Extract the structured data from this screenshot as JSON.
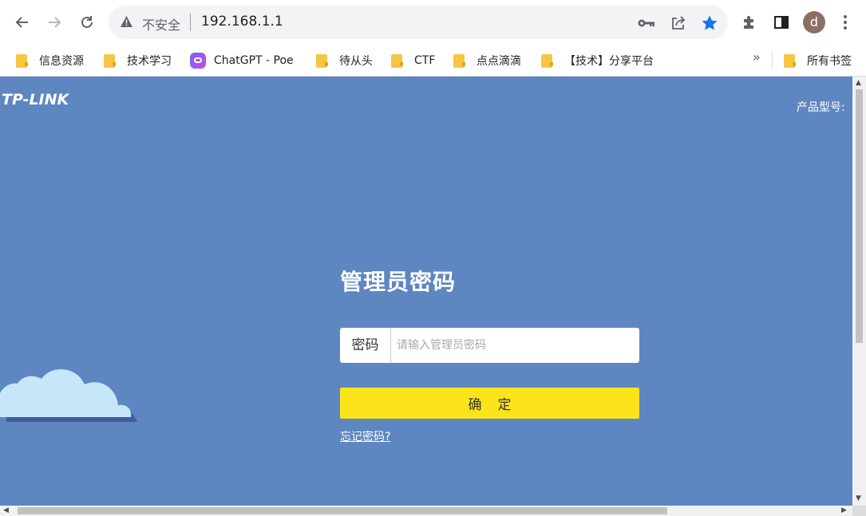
{
  "browser": {
    "security_label": "不安全",
    "url": "192.168.1.1",
    "avatar_letter": "d"
  },
  "bookmarks": {
    "items": [
      {
        "label": "信息资源",
        "icon": "folder-icon"
      },
      {
        "label": "技术学习",
        "icon": "folder-icon"
      },
      {
        "label": "ChatGPT - Poe",
        "icon": "poe-icon"
      },
      {
        "label": "待从头",
        "icon": "folder-icon"
      },
      {
        "label": "CTF",
        "icon": "folder-icon"
      },
      {
        "label": "点点滴滴",
        "icon": "folder-icon"
      },
      {
        "label": "【技术】分享平台",
        "icon": "folder-icon"
      }
    ],
    "overflow_chevron": "»",
    "all_bookmarks_label": "所有书签"
  },
  "page": {
    "logo": "TP-LINK",
    "model_label": "产品型号:",
    "login_title": "管理员密码",
    "password_label": "密码",
    "password_placeholder": "请输入管理员密码",
    "confirm_label": "确定",
    "forgot_label": "忘记密码?"
  },
  "colors": {
    "page_background": "#5e86c1",
    "confirm_button": "#fbe419",
    "star_accent": "#1a73e8"
  }
}
